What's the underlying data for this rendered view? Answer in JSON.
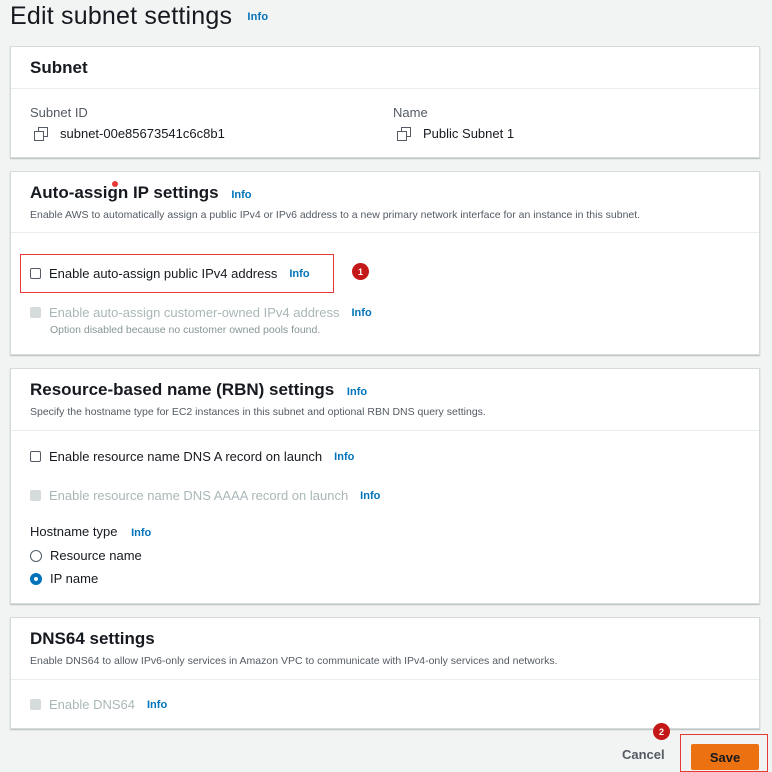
{
  "page": {
    "title": "Edit subnet settings",
    "info": "Info"
  },
  "subnet": {
    "title": "Subnet",
    "id_label": "Subnet ID",
    "id_value": "subnet-00e85673541c6c8b1",
    "name_label": "Name",
    "name_value": "Public Subnet 1"
  },
  "auto_assign": {
    "title": "Auto-assign IP settings",
    "info": "Info",
    "description": "Enable AWS to automatically assign a public IPv4 or IPv6 address to a new primary network interface for an instance in this subnet.",
    "public_ipv4_label": "Enable auto-assign public IPv4 address",
    "public_ipv4_checked": false,
    "customer_owned_label": "Enable auto-assign customer-owned IPv4 address",
    "customer_owned_disabled": true,
    "customer_owned_note": "Option disabled because no customer owned pools found.",
    "info2": "Info",
    "info3": "Info"
  },
  "rbn": {
    "title": "Resource-based name (RBN) settings",
    "info": "Info",
    "description": "Specify the hostname type for EC2 instances in this subnet and optional RBN DNS query settings.",
    "dns_a_label": "Enable resource name DNS A record on launch",
    "dns_a_info": "Info",
    "dns_aaaa_label": "Enable resource name DNS AAAA record on launch",
    "dns_aaaa_info": "Info",
    "hostname_type_label": "Hostname type",
    "hostname_type_info": "Info",
    "hostname_options": [
      "Resource name",
      "IP name"
    ],
    "hostname_selected": "IP name"
  },
  "dns64": {
    "title": "DNS64 settings",
    "description": "Enable DNS64 to allow IPv6-only services in Amazon VPC to communicate with IPv4-only services and networks.",
    "enable_label": "Enable DNS64",
    "enable_info": "Info"
  },
  "actions": {
    "cancel": "Cancel",
    "save": "Save"
  },
  "annotations": {
    "step1": "1",
    "step2": "2"
  },
  "colors": {
    "accent": "#0073bb",
    "primary_button": "#ec7211",
    "highlight": "#e53935"
  }
}
